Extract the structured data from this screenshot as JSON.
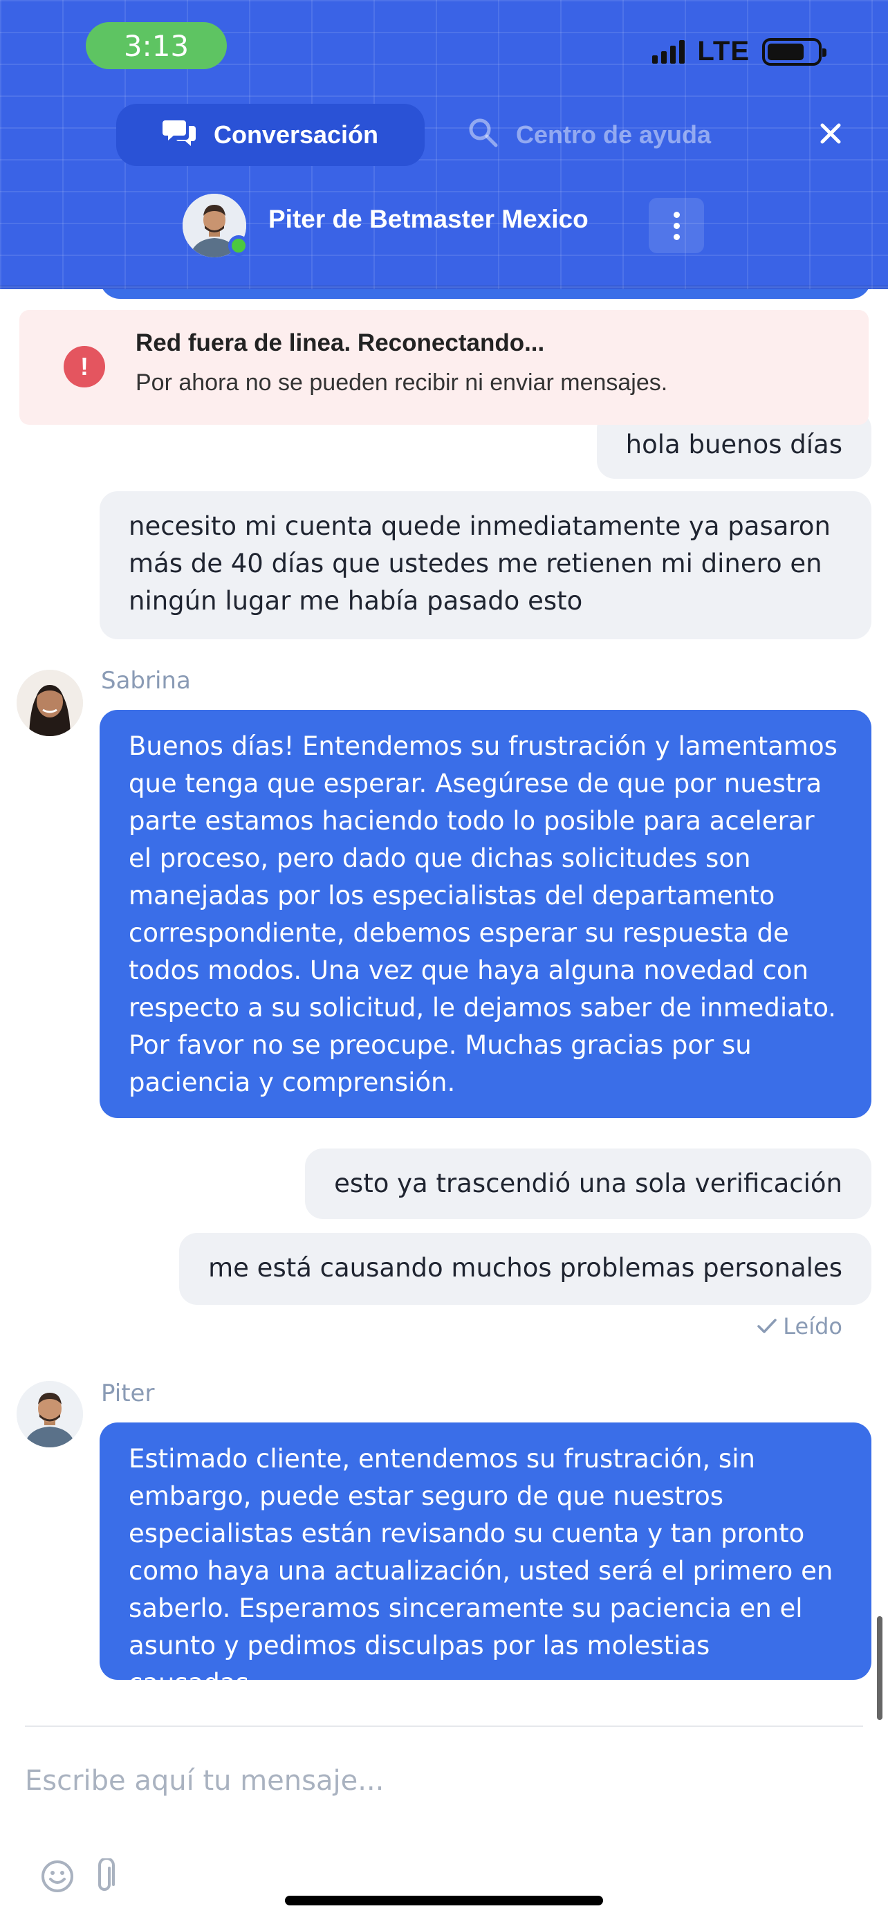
{
  "status_bar": {
    "time": "3:13",
    "network": "LTE",
    "battery_level": 0.74
  },
  "header": {
    "tabs": [
      {
        "label": "Conversación",
        "icon": "chat-bubbles-icon",
        "active": true
      },
      {
        "label": "Centro de ayuda",
        "icon": "search-icon",
        "active": false
      }
    ],
    "close_icon": "close-icon",
    "agent_title": "Piter de Betmaster Mexico",
    "agent_online": true,
    "menu_icon": "kebab-menu-icon",
    "background_color": "#3a63e6"
  },
  "banner": {
    "icon": "alert-icon",
    "title": "Red fuera de linea. Reconectando...",
    "subtitle": "Por ahora no se pueden recibir ni enviar mensajes."
  },
  "messages": [
    {
      "from": "user",
      "text": "hola buenos días"
    },
    {
      "from": "user",
      "text": "necesito mi cuenta quede inmediatamente ya pasaron\nmás de 40 días que ustedes me retienen mi dinero en\nningún lugar me había pasado esto"
    },
    {
      "from": "agent",
      "sender": "Sabrina",
      "text": "Buenos días! Entendemos su frustración y lamentamos que tenga que esperar. Asegúrese de que por nuestra parte estamos haciendo todo lo posible para acelerar el proceso, pero dado que dichas solicitudes son manejadas por los especialistas del departamento correspondiente, debemos esperar su respuesta de todos modos. Una vez que haya alguna novedad con respecto a su solicitud, le dejamos saber de inmediato. Por favor no se preocupe. Muchas gracias por su paciencia y comprensión."
    },
    {
      "from": "user",
      "text": "esto ya trascendió una sola verificación"
    },
    {
      "from": "user",
      "text": "me está causando muchos problemas personales"
    },
    {
      "from": "agent",
      "sender": "Piter",
      "text": "Estimado cliente, entendemos su frustración, sin embargo, puede estar seguro de que nuestros especialistas están revisando su cuenta y tan pronto como haya una actualización, usted será el primero en saberlo. Esperamos sinceramente su paciencia en el asunto y pedimos disculpas por las molestias causadas."
    }
  ],
  "read_status": "Leído",
  "composer": {
    "placeholder": "Escribe aquí tu mensaje...",
    "icons": [
      "emoji-icon",
      "attachment-icon"
    ]
  },
  "colors": {
    "agent_bubble": "#3a6ee8",
    "user_bubble": "#eff1f5",
    "online": "#4cc83e",
    "alert": "#e4555f"
  }
}
